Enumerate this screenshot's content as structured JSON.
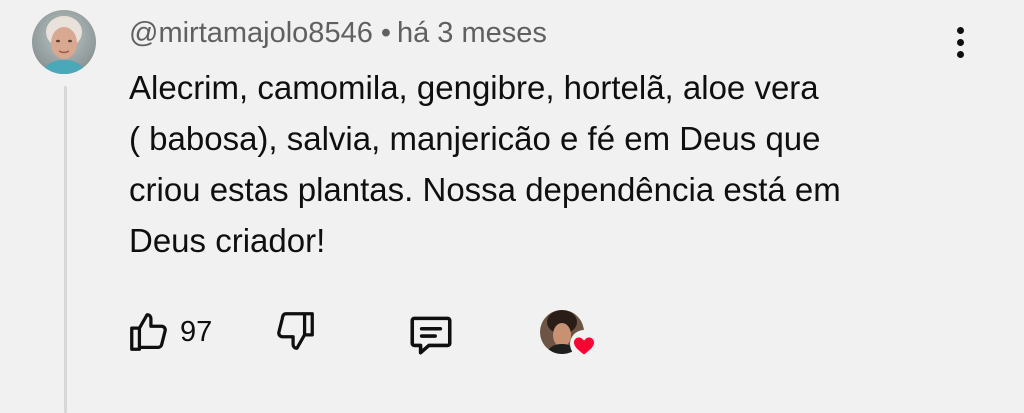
{
  "comment": {
    "author": "@mirtamajolo8546",
    "separator": "•",
    "time": "há 3 meses",
    "text_lines": [
      "Alecrim, camomila, gengibre, hortelã, aloe vera",
      "( babosa), salvia, manjericão e fé em Deus que",
      "criou estas plantas. Nossa dependência está em",
      "Deus criador!"
    ]
  },
  "actions": {
    "like_count": "97",
    "icons": {
      "like": "thumbs-up-icon",
      "dislike": "thumbs-down-icon",
      "reply": "comment-icon",
      "menu": "more-vertical-icon",
      "heart": "heart-icon"
    }
  },
  "colors": {
    "background": "#f1f1f1",
    "text": "#0f0f0f",
    "secondary_text": "#606060",
    "heart": "#f03",
    "thread_line": "#d7d7d7"
  }
}
